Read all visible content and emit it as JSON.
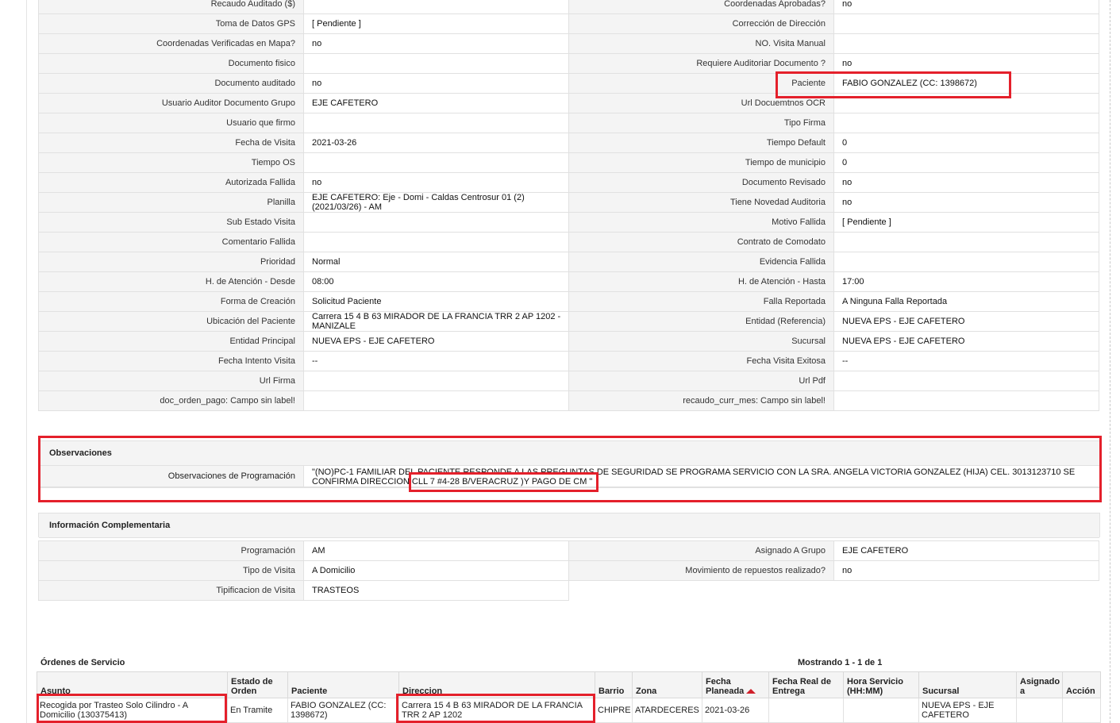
{
  "details": {
    "rows": [
      [
        "Recaudo Auditado ($)",
        "",
        "Coordenadas Aprobadas?",
        "no"
      ],
      [
        "Toma de Datos GPS",
        "[ Pendiente ]",
        "Corrección de Dirección",
        ""
      ],
      [
        "Coordenadas Verificadas en Mapa?",
        "no",
        "NO. Visita Manual",
        ""
      ],
      [
        "Documento fisico",
        "",
        "Requiere Auditoriar Documento ?",
        "no"
      ],
      [
        "Documento auditado",
        "no",
        "Paciente",
        "FABIO GONZALEZ (CC: 1398672)"
      ],
      [
        "Usuario Auditor Documento Grupo",
        "EJE CAFETERO",
        "Url Docuemtnos OCR",
        ""
      ],
      [
        "Usuario que firmo",
        "",
        "Tipo Firma",
        ""
      ],
      [
        "Fecha de Visita",
        "2021-03-26",
        "Tiempo Default",
        "0"
      ],
      [
        "Tiempo OS",
        "",
        "Tiempo de municipio",
        "0"
      ],
      [
        "Autorizada Fallida",
        "no",
        "Documento Revisado",
        "no"
      ],
      [
        "Planilla",
        "EJE CAFETERO: Eje - Domi - Caldas Centrosur 01 (2) (2021/03/26) - AM",
        "Tiene Novedad Auditoria",
        "no"
      ],
      [
        "Sub Estado Visita",
        "",
        "Motivo Fallida",
        "[ Pendiente ]"
      ],
      [
        "Comentario Fallida",
        "",
        "Contrato de Comodato",
        ""
      ],
      [
        "Prioridad",
        "Normal",
        "Evidencia Fallida",
        ""
      ],
      [
        "H. de Atención - Desde",
        "08:00",
        "H. de Atención - Hasta",
        "17:00"
      ],
      [
        "Forma de Creación",
        "Solicitud Paciente",
        "Falla Reportada",
        "A Ninguna Falla Reportada"
      ],
      [
        "Ubicación del Paciente",
        "Carrera 15 4 B 63 MIRADOR DE LA FRANCIA TRR 2 AP 1202 - MANIZALE",
        "Entidad (Referencia)",
        "NUEVA EPS - EJE CAFETERO"
      ],
      [
        "Entidad Principal",
        "NUEVA EPS - EJE CAFETERO",
        "Sucursal",
        "NUEVA EPS - EJE CAFETERO"
      ],
      [
        "Fecha Intento Visita",
        "--",
        "Fecha Visita Exitosa",
        "--"
      ],
      [
        "Url Firma",
        "",
        "Url Pdf",
        ""
      ],
      [
        "doc_orden_pago: Campo sin label!",
        "",
        "recaudo_curr_mes: Campo sin label!",
        ""
      ]
    ]
  },
  "observaciones": {
    "title": "Observaciones",
    "label": "Observaciones de Programación",
    "value": "\"(NO)PC-1 FAMILIAR DEL PACIENTE RESPONDE A LAS PREGUNTAS DE SEGURIDAD SE PROGRAMA SERVICIO CON LA SRA. ANGELA VICTORIA GONZALEZ (HIJA) CEL. 3013123710 SE CONFIRMA DIRECCION CLL 7 #4-28 B/VERACRUZ )Y PAGO DE CM \""
  },
  "info": {
    "title": "Información Complementaria",
    "rows": [
      [
        "Programación",
        "AM",
        "Asignado A Grupo",
        "EJE CAFETERO"
      ],
      [
        "Tipo de Visita",
        "A Domicilio",
        "Movimiento de repuestos realizado?",
        "no"
      ],
      [
        "Tipificacion de Visita",
        "TRASTEOS",
        "",
        ""
      ]
    ]
  },
  "orders": {
    "title": "Órdenes de Servicio",
    "count": "Mostrando 1 - 1 de 1",
    "headers": [
      "Asunto",
      "Estado de Orden",
      "Paciente",
      "Direccion",
      "Barrio",
      "Zona",
      "Fecha Planeada",
      "Fecha Real de Entrega",
      "Hora Servicio (HH:MM)",
      "Sucursal",
      "Asignado a",
      "Acción"
    ],
    "rows": [
      [
        "Recogida por Trasteo Solo Cilindro - A Domicilio (130375413)",
        "En Tramite",
        "FABIO GONZALEZ (CC: 1398672)",
        "Carrera 15 4 B 63 MIRADOR DE LA FRANCIA TRR 2 AP 1202",
        "CHIPRE",
        "ATARDECERES",
        "2021-03-26",
        "",
        "",
        "NUEVA EPS - EJE CAFETERO",
        "",
        ""
      ]
    ]
  }
}
